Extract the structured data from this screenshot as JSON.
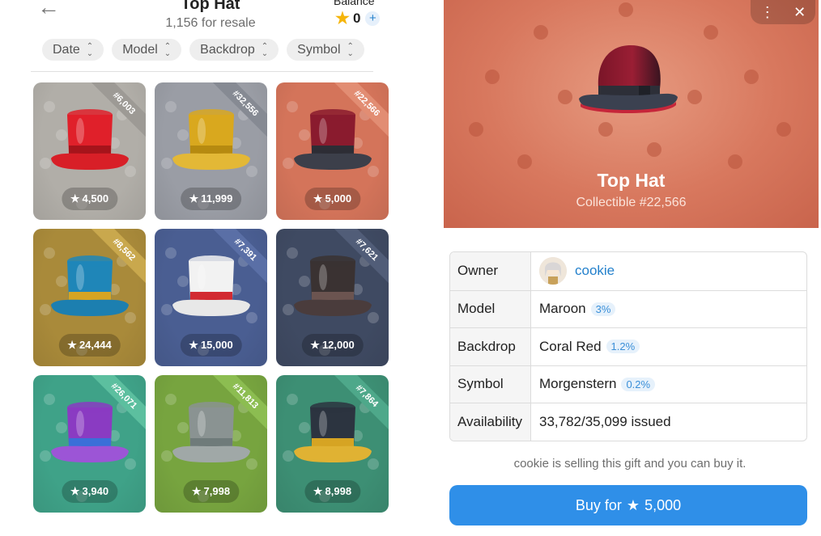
{
  "header": {
    "back_icon": "back-arrow-icon",
    "title": "Top Hat",
    "subtitle": "1,156 for resale",
    "balance_label": "Balance",
    "balance_value": "0",
    "balance_plus": "+"
  },
  "filters": [
    {
      "label": "Date"
    },
    {
      "label": "Model"
    },
    {
      "label": "Backdrop"
    },
    {
      "label": "Symbol"
    }
  ],
  "cards": [
    {
      "number": "#6,003",
      "price": "4,500",
      "bg": "#b1aea8",
      "ribbon": "#9d9a95",
      "hat": "#e0202a",
      "band": "#a6141b",
      "brim": "#d81f27"
    },
    {
      "number": "#32,556",
      "price": "11,999",
      "bg": "#9a9da5",
      "ribbon": "#868a93",
      "hat": "#d9a81e",
      "band": "#b68a10",
      "brim": "#e3b836"
    },
    {
      "number": "#22,566",
      "price": "5,000",
      "bg": "#d4745a",
      "ribbon": "#e28d73",
      "hat": "#8a1b2e",
      "band": "#2d2d35",
      "brim": "#3c3f4a"
    },
    {
      "number": "#8,562",
      "price": "24,444",
      "bg": "#a98a3a",
      "ribbon": "#c9a84d",
      "hat": "#1f86b8",
      "band": "#d6a423",
      "brim": "#1c7fb0"
    },
    {
      "number": "#7,391",
      "price": "15,000",
      "bg": "#4a5e92",
      "ribbon": "#5a6fa6",
      "hat": "#f2f2f2",
      "band": "#d22b32",
      "brim": "#e8e8e8"
    },
    {
      "number": "#7,621",
      "price": "12,000",
      "bg": "#3f4a62",
      "ribbon": "#515d78",
      "hat": "#3a3232",
      "band": "#6b5450",
      "brim": "#4a3c3c"
    },
    {
      "number": "#26,071",
      "price": "3,940",
      "bg": "#3fa288",
      "ribbon": "#5cbf9f",
      "hat": "#8a3bc2",
      "band": "#3a6fd8",
      "brim": "#9c55d6"
    },
    {
      "number": "#11,813",
      "price": "7,998",
      "bg": "#77a43f",
      "ribbon": "#8cbd51",
      "hat": "#8a9392",
      "band": "#6f7b7a",
      "brim": "#a0a8a7"
    },
    {
      "number": "#7,864",
      "price": "8,998",
      "bg": "#3d8f74",
      "ribbon": "#4ea88a",
      "hat": "#2c3440",
      "band": "#d6a423",
      "brim": "#e0b233"
    }
  ],
  "detail": {
    "menu_icon": "more-vertical-icon",
    "close_icon": "close-icon",
    "name": "Top Hat",
    "collectible": "Collectible #22,566",
    "rows": {
      "owner_label": "Owner",
      "owner_value": "cookie",
      "model_label": "Model",
      "model_value": "Maroon",
      "model_pct": "3%",
      "backdrop_label": "Backdrop",
      "backdrop_value": "Coral Red",
      "backdrop_pct": "1.2%",
      "symbol_label": "Symbol",
      "symbol_value": "Morgenstern",
      "symbol_pct": "0.2%",
      "availability_label": "Availability",
      "availability_value": "33,782/35,099 issued"
    },
    "note": "cookie is selling this gift and you can buy it.",
    "buy_prefix": "Buy for",
    "buy_price": "5,000"
  },
  "icons": {
    "star": "star-icon",
    "chevron": "chevron-up-down-icon"
  }
}
